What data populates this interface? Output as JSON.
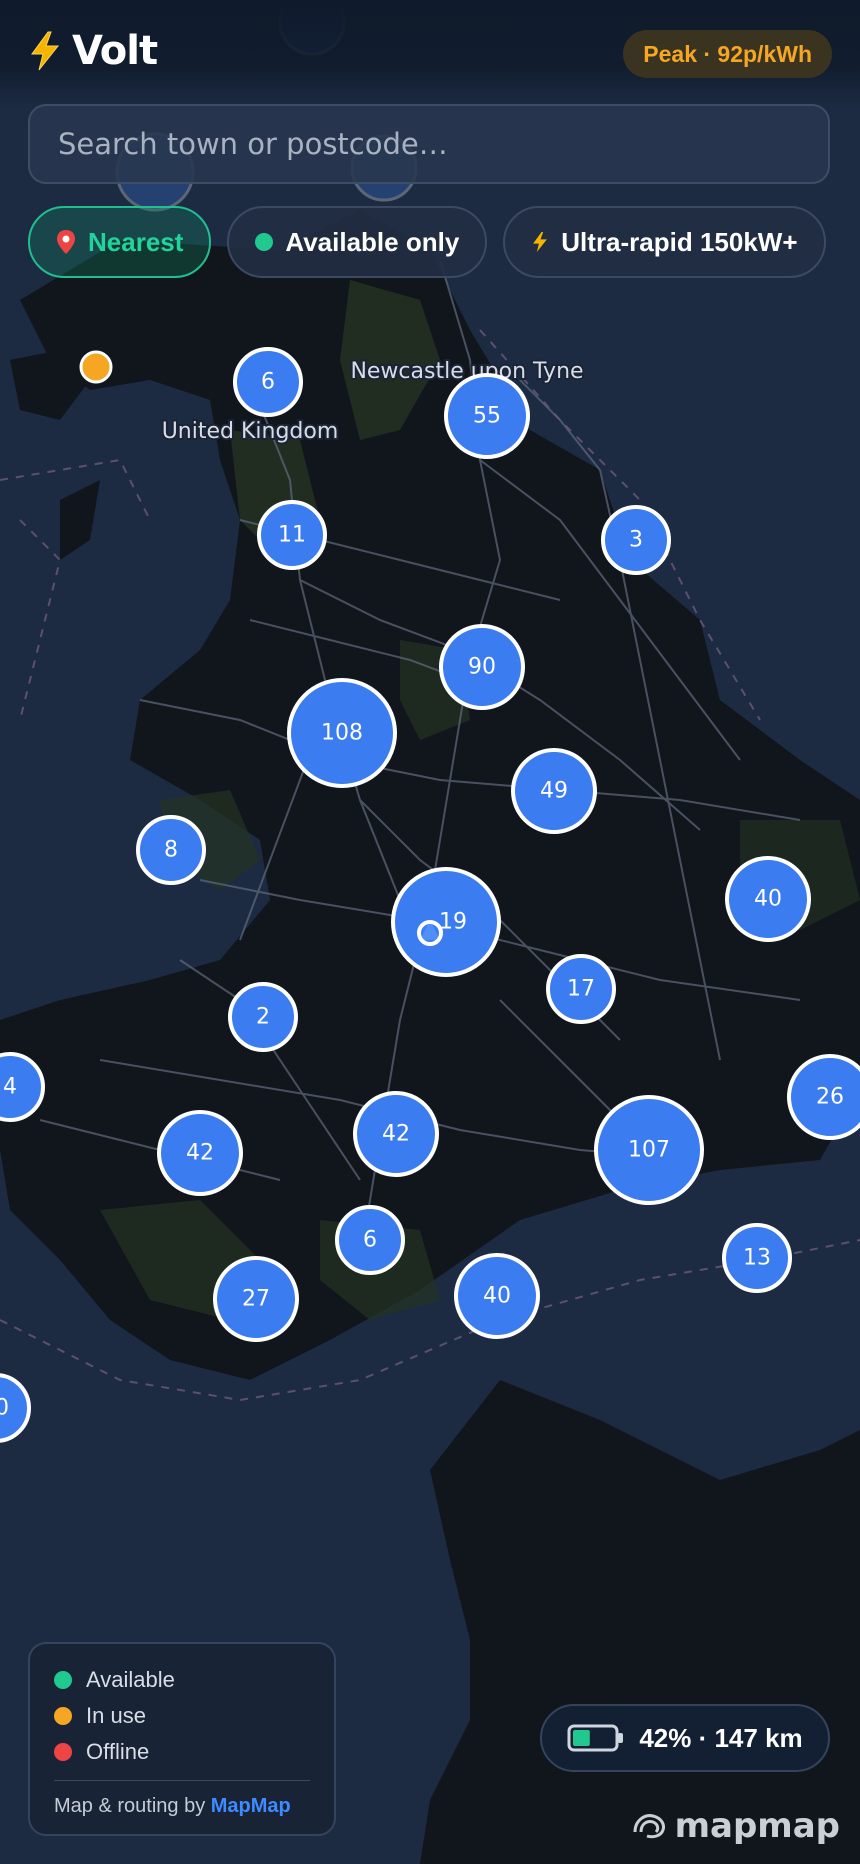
{
  "app": {
    "name": "Volt",
    "peak_badge": "Peak · 92p/kWh"
  },
  "search": {
    "placeholder": "Search town or postcode…"
  },
  "filters": [
    {
      "label": "Nearest",
      "icon": "pin-icon",
      "active": true
    },
    {
      "label": "Available only",
      "icon": "green-dot-icon",
      "active": false
    },
    {
      "label": "Ultra-rapid 150kW+",
      "icon": "bolt-icon",
      "active": false
    }
  ],
  "map_labels": {
    "city": "Newcastle upon Tyne",
    "country": "United Kingdom"
  },
  "clusters": [
    "6",
    "55",
    "11",
    "3",
    "90",
    "108",
    "49",
    "8",
    "19",
    "40",
    "17",
    "2",
    "4",
    "26",
    "42",
    "42",
    "107",
    "6",
    "27",
    "40",
    "13",
    "0"
  ],
  "legend": {
    "items": [
      {
        "label": "Available",
        "color": "#22c98e"
      },
      {
        "label": "In use",
        "color": "#f5a623"
      },
      {
        "label": "Offline",
        "color": "#ef4444"
      }
    ],
    "credit_prefix": "Map & routing by",
    "credit_brand": "MapMap"
  },
  "battery": {
    "text": "42% · 147 km",
    "level": 0.42
  },
  "logo": {
    "text": "mapmap"
  },
  "colors": {
    "cluster": "#3b7cf0",
    "accent": "#22c98e",
    "peak": "#f5a623",
    "in_use": "#f5a623"
  }
}
